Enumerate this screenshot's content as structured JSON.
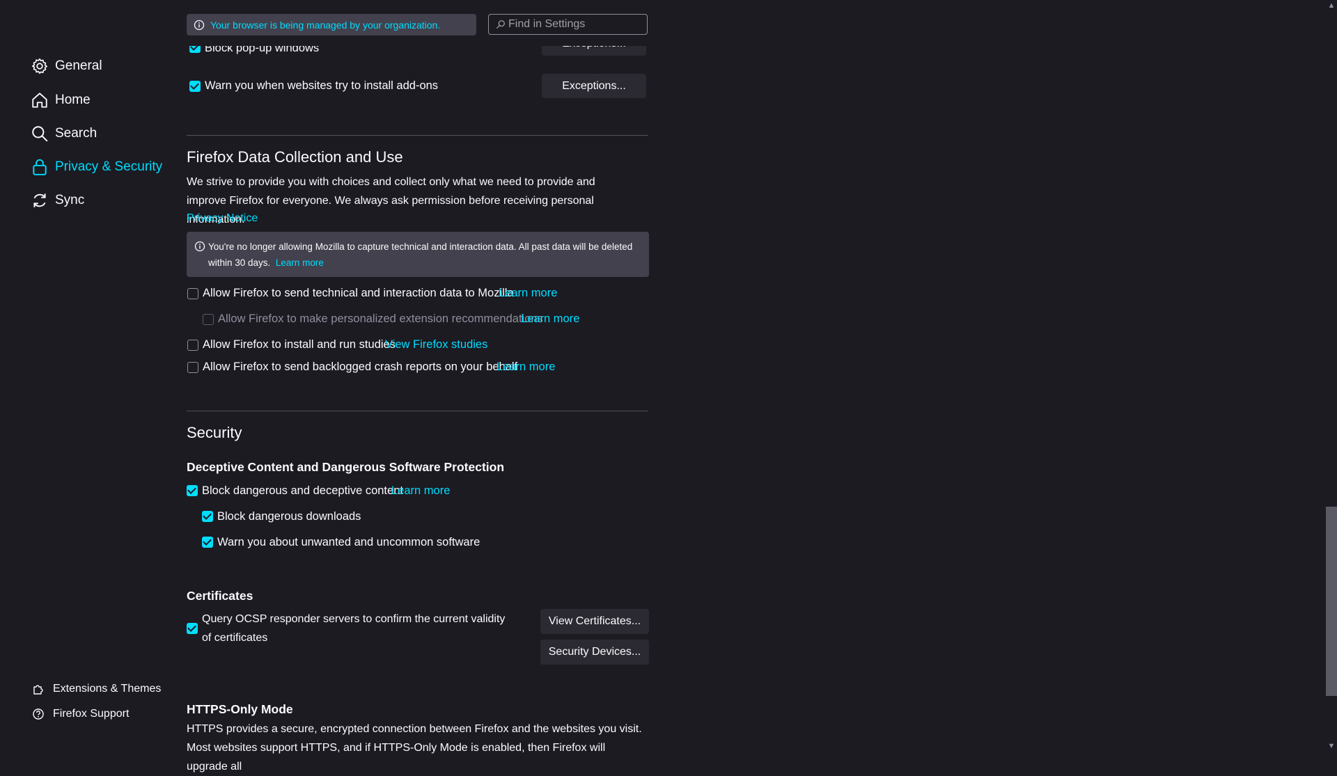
{
  "topbar": {
    "managed_text": "Your browser is being managed by your organization.",
    "search_placeholder": "Find in Settings"
  },
  "sidebar": {
    "items": [
      {
        "label": "General"
      },
      {
        "label": "Home"
      },
      {
        "label": "Search"
      },
      {
        "label": "Privacy & Security"
      },
      {
        "label": "Sync"
      }
    ],
    "footer": [
      {
        "label": "Extensions & Themes"
      },
      {
        "label": "Firefox Support"
      }
    ]
  },
  "permissions": {
    "block_popups_label": "Block pop-up windows",
    "warn_addons_label": "Warn you when websites try to install add-ons",
    "exceptions_label": "Exceptions..."
  },
  "data_collection": {
    "title": "Firefox Data Collection and Use",
    "description": "We strive to provide you with choices and collect only what we need to provide and improve Firefox for everyone. We always ask permission before receiving personal information.",
    "privacy_notice": "Privacy Notice",
    "notice_text": "You're no longer allowing Mozilla to capture technical and interaction data. All past data will be deleted within 30 days.",
    "notice_link": "Learn more",
    "opt_technical": "Allow Firefox to send technical and interaction data to Mozilla",
    "opt_extension": "Allow Firefox to make personalized extension recommendations",
    "opt_studies": "Allow Firefox to install and run studies",
    "view_studies": "View Firefox studies",
    "opt_crash": "Allow Firefox to send backlogged crash reports on your behalf",
    "learn_more": "Learn more"
  },
  "security": {
    "title": "Security",
    "deceptive_heading": "Deceptive Content and Dangerous Software Protection",
    "block_deceptive": "Block dangerous and deceptive content",
    "learn_more": "Learn more",
    "block_downloads": "Block dangerous downloads",
    "warn_unwanted": "Warn you about unwanted and uncommon software",
    "certificates_heading": "Certificates",
    "ocsp_label": "Query OCSP responder servers to confirm the current validity of certificates",
    "view_certificates": "View Certificates...",
    "security_devices": "Security Devices...",
    "https_heading": "HTTPS-Only Mode",
    "https_text": "HTTPS provides a secure, encrypted connection between Firefox and the websites you visit. Most websites support HTTPS, and if HTTPS-Only Mode is enabled, then Firefox will upgrade all"
  },
  "colors": {
    "background": "#1c1b22",
    "accent": "#00ddff",
    "panel": "#42414d",
    "button": "#2b2a33"
  }
}
